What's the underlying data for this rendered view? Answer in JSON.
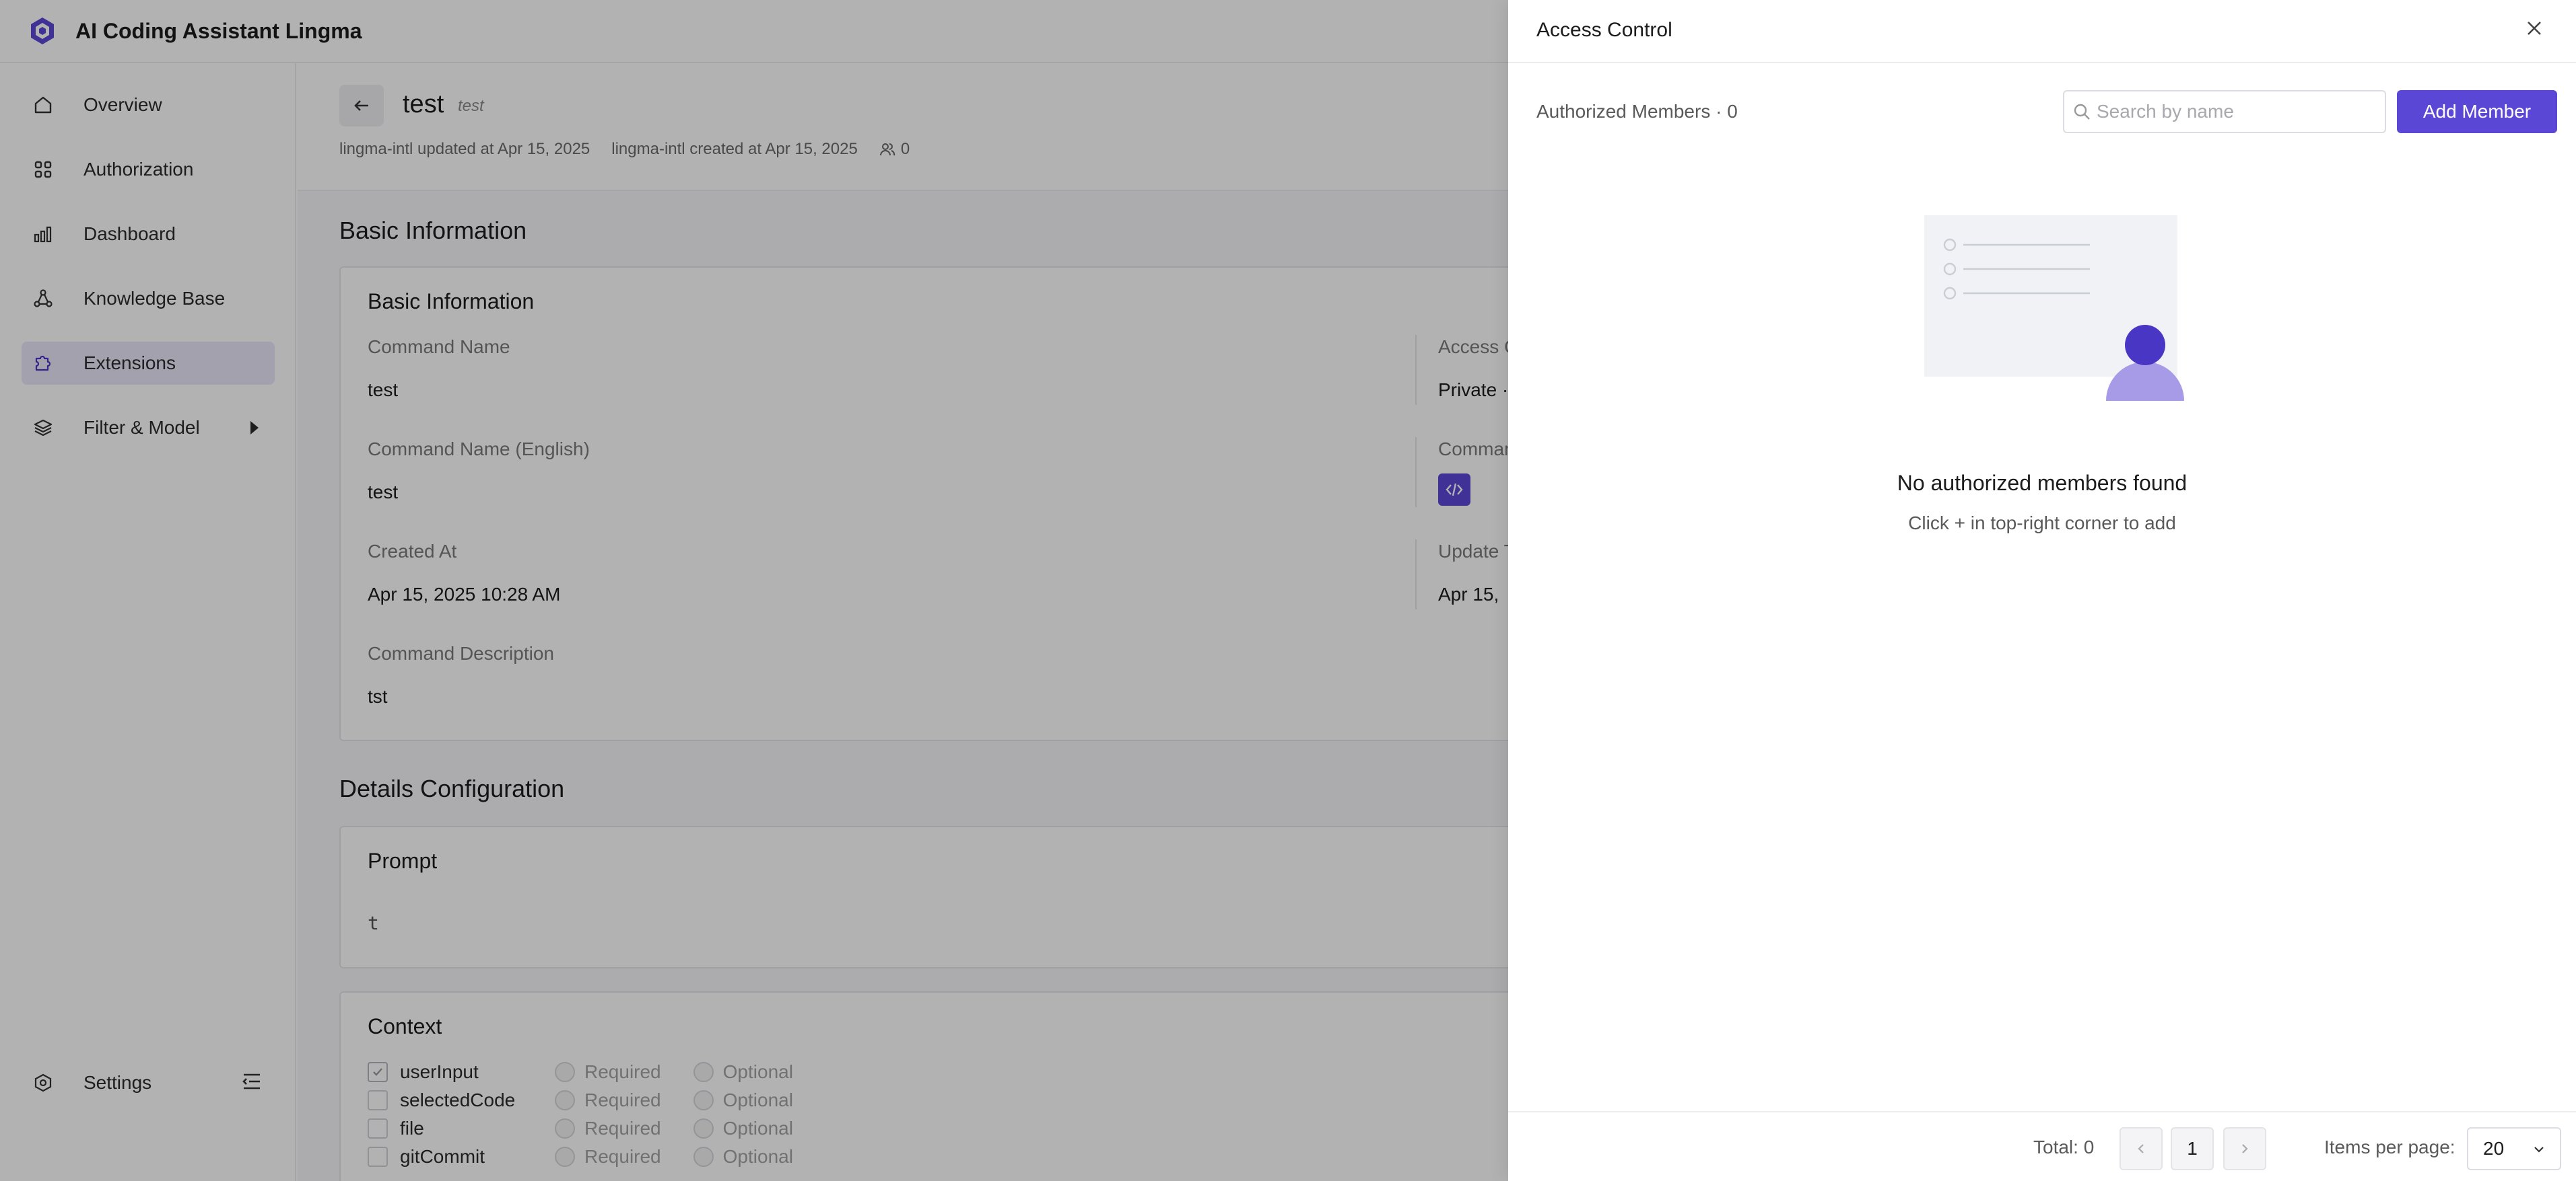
{
  "app": {
    "title": "AI Coding Assistant Lingma"
  },
  "sidebar": {
    "items": [
      {
        "label": "Overview",
        "icon": "home-icon"
      },
      {
        "label": "Authorization",
        "icon": "grid-icon"
      },
      {
        "label": "Dashboard",
        "icon": "bar-chart-icon"
      },
      {
        "label": "Knowledge Base",
        "icon": "nodes-icon"
      },
      {
        "label": "Extensions",
        "icon": "puzzle-icon",
        "active": true
      },
      {
        "label": "Filter & Model",
        "icon": "layers-icon",
        "has_submenu": true
      }
    ],
    "settings_label": "Settings"
  },
  "page": {
    "title": "test",
    "subtitle": "test",
    "updated_by": "lingma-intl updated at Apr 15, 2025",
    "created_by": "lingma-intl created at Apr 15, 2025",
    "member_count": "0"
  },
  "basic": {
    "section_title": "Basic Information",
    "card_title": "Basic Information",
    "command_name_label": "Command Name",
    "command_name": "test",
    "command_name_en_label": "Command Name (English)",
    "command_name_en": "test",
    "created_at_label": "Created At",
    "created_at": "Apr 15, 2025 10:28 AM",
    "description_label": "Command Description",
    "description": "tst",
    "access_label_partial": "Access C",
    "access_value_partial": "Private ·",
    "command_icon_label_partial": "Comman",
    "update_label_partial": "Update T",
    "update_value_partial": "Apr 15,"
  },
  "details": {
    "section_title": "Details Configuration",
    "prompt_title": "Prompt",
    "prompt_value": "t",
    "context_title": "Context",
    "required_label": "Required",
    "optional_label": "Optional",
    "context_items": [
      {
        "name": "userInput",
        "checked": true
      },
      {
        "name": "selectedCode",
        "checked": false
      },
      {
        "name": "file",
        "checked": false
      },
      {
        "name": "gitCommit",
        "checked": false
      }
    ]
  },
  "drawer": {
    "title": "Access Control",
    "authorized_members": "Authorized Members · 0",
    "search_placeholder": "Search by name",
    "add_member_label": "Add Member",
    "empty_title": "No authorized members found",
    "empty_hint": "Click + in top-right corner to add",
    "total_label": "Total: 0",
    "current_page": "1",
    "items_per_page_label": "Items per page:",
    "items_per_page_value": "20"
  },
  "colors": {
    "accent": "#5b47d6",
    "active_nav_bg": "#ebe7fb",
    "illustration_light": "#f0f2f5",
    "avatar_head": "#4a36c4",
    "avatar_body": "#a79be8"
  }
}
